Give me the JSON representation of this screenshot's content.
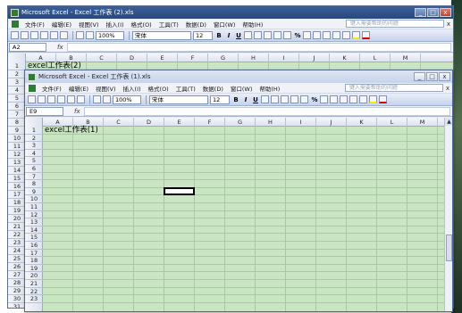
{
  "back_window": {
    "title": "Microsoft Excel - Excel 工作表 (2).xls",
    "menus": [
      "文件(F)",
      "编辑(E)",
      "视图(V)",
      "插入(I)",
      "格式(O)",
      "工具(T)",
      "数据(D)",
      "窗口(W)",
      "帮助(H)"
    ],
    "help_placeholder": "键入需要帮助的问题",
    "zoom": "100%",
    "font": "宋体",
    "font_size": "12",
    "name_box": "A2",
    "fx": "fx",
    "columns": [
      "A",
      "B",
      "C",
      "D",
      "E",
      "F",
      "G",
      "H",
      "I",
      "J",
      "K",
      "L",
      "M"
    ],
    "rows": [
      "1",
      "2",
      "3",
      "4",
      "5",
      "6",
      "7",
      "8",
      "9",
      "10",
      "11",
      "12",
      "13",
      "14",
      "15",
      "16",
      "17",
      "18",
      "19",
      "20",
      "21",
      "22",
      "23",
      "24",
      "25",
      "26",
      "27",
      "28",
      "29",
      "30",
      "31"
    ],
    "cell_a1": "excel工作表(2)"
  },
  "front_window": {
    "title": "Microsoft Excel - Excel 工作表 (1).xls",
    "menus": [
      "文件(F)",
      "编辑(E)",
      "视图(V)",
      "插入(I)",
      "格式(O)",
      "工具(T)",
      "数据(D)",
      "窗口(W)",
      "帮助(H)"
    ],
    "help_placeholder": "键入需要帮助的问题",
    "zoom": "100%",
    "font": "宋体",
    "font_size": "12",
    "name_box": "E9",
    "fx": "fx",
    "columns": [
      "A",
      "B",
      "C",
      "D",
      "E",
      "F",
      "G",
      "H",
      "I",
      "J",
      "K",
      "L",
      "M"
    ],
    "rows": [
      "1",
      "2",
      "3",
      "4",
      "5",
      "6",
      "7",
      "8",
      "9",
      "10",
      "11",
      "12",
      "13",
      "14",
      "15",
      "16",
      "17",
      "18",
      "19",
      "20",
      "21",
      "22",
      "23"
    ],
    "cell_a1": "excel工作表(1)"
  },
  "toolbar_format_buttons": {
    "bold": "B",
    "italic": "I",
    "underline": "U",
    "percent": "%"
  },
  "window_controls": {
    "minimize": "_",
    "maximize": "□",
    "close": "x"
  }
}
